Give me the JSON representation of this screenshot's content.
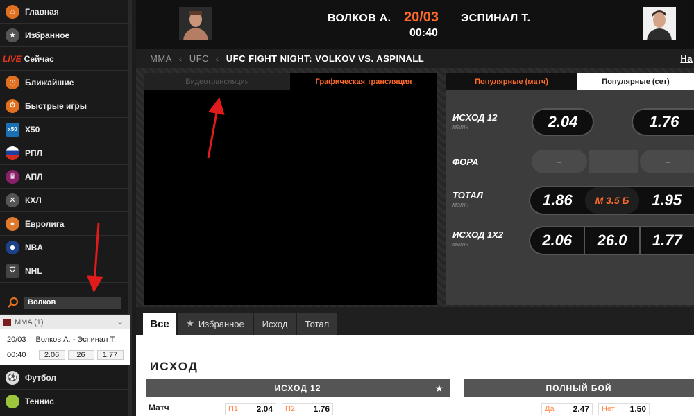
{
  "sidebar": {
    "items": [
      {
        "label": "Главная",
        "icon": "home-icon",
        "color": "#e0701f"
      },
      {
        "label": "Избранное",
        "icon": "star-icon",
        "color": "#555555"
      },
      {
        "label": "Сейчас",
        "icon": "live-icon",
        "live": "LIVE"
      },
      {
        "label": "Ближайшие",
        "icon": "clock-icon",
        "color": "#e0701f"
      },
      {
        "label": "Быстрые игры",
        "icon": "stopwatch-icon",
        "color": "#e0701f"
      },
      {
        "label": "X50",
        "icon": "x50-icon",
        "color": "#1a6fb5"
      },
      {
        "label": "РПЛ",
        "icon": "russia-flag-icon",
        "color": "#d52b1e"
      },
      {
        "label": "АПЛ",
        "icon": "epl-icon",
        "color": "#8a1f6a"
      },
      {
        "label": "КХЛ",
        "icon": "khl-icon",
        "color": "#555555"
      },
      {
        "label": "Евролига",
        "icon": "basketball-icon",
        "color": "#e07a2a"
      },
      {
        "label": "NBA",
        "icon": "nba-icon",
        "color": "#1d428a"
      },
      {
        "label": "NHL",
        "icon": "nhl-icon",
        "color": "#444444"
      }
    ],
    "search": {
      "value": "Волков"
    },
    "mma_group": {
      "label": "MMA (1)"
    },
    "event": {
      "date": "20/03",
      "teams": "Волков А. - Эспинал Т.",
      "time": "00:40",
      "odds": [
        "2.06",
        "26",
        "1.77"
      ]
    },
    "bottom_items": [
      {
        "label": "Футбол",
        "icon": "football-icon"
      },
      {
        "label": "Теннис",
        "icon": "tennis-icon"
      }
    ]
  },
  "header": {
    "fighter1": "ВОЛКОВ А.",
    "fighter2": "ЭСПИНАЛ Т.",
    "date": "20/03",
    "time": "00:40"
  },
  "breadcrumb": {
    "items": [
      "MMA",
      "UFC"
    ],
    "current": "UFC FIGHT NIGHT: VOLKOV VS. ASPINALL",
    "tail": "На"
  },
  "video": {
    "tab_video": "Видеотрансляция",
    "tab_graphic": "Графическая трансляция"
  },
  "odds_panel": {
    "tab_popular_match": "Популярные (матч)",
    "tab_popular_set": "Популярные (сет)",
    "markets": {
      "ishod12": {
        "name": "ИСХОД 12",
        "sub": "матч",
        "odd1": "2.04",
        "odd2": "1.76"
      },
      "fora": {
        "name": "ФОРА",
        "odd1": "–",
        "odd2": "–"
      },
      "total": {
        "name": "ТОТАЛ",
        "sub": "матч",
        "over": "1.86",
        "line": "М 3.5 Б",
        "under": "1.95"
      },
      "ishod1x2": {
        "name": "ИСХОД 1Х2",
        "sub": "матч",
        "odd1": "2.06",
        "oddx": "26.0",
        "odd2": "1.77"
      }
    }
  },
  "bottom_tabs": {
    "all": "Все",
    "favorites": "Избранное",
    "outcome": "Исход",
    "total": "Тотал"
  },
  "lower": {
    "section_title": "ИСХОД",
    "bar_left": "ИСХОД 12",
    "bar_right": "ПОЛНЫЙ БОЙ",
    "row_label": "Матч",
    "p1_tag": "П1",
    "p1_val": "2.04",
    "p2_tag": "П2",
    "p2_val": "1.76",
    "yes_tag": "Да",
    "yes_val": "2.47",
    "no_tag": "Нет",
    "no_val": "1.50"
  },
  "colors": {
    "accent": "#ff6a2a",
    "live": "#e8371d",
    "annotation_arrow": "#e01b1b"
  }
}
